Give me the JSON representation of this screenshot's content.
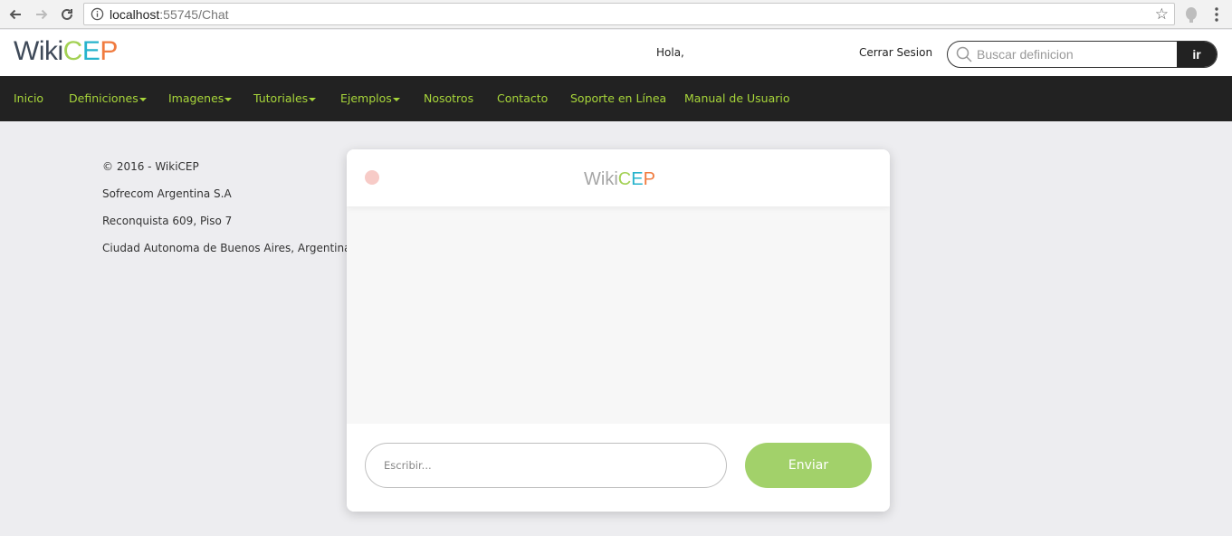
{
  "browser": {
    "url_host": "localhost",
    "url_rest": ":55745/Chat"
  },
  "header": {
    "logo": {
      "wiki": "Wiki",
      "c": "C",
      "e": "E",
      "p": "P"
    },
    "greeting": "Hola,",
    "logout_label": "Cerrar Sesion",
    "search_placeholder": "Buscar definicion",
    "search_button": "ir"
  },
  "nav": {
    "items": [
      {
        "label": "Inicio",
        "dropdown": false
      },
      {
        "label": "Definiciones",
        "dropdown": true
      },
      {
        "label": "Imagenes",
        "dropdown": true
      },
      {
        "label": "Tutoriales",
        "dropdown": true
      },
      {
        "label": "Ejemplos",
        "dropdown": true
      },
      {
        "label": "Nosotros",
        "dropdown": false
      },
      {
        "label": "Contacto",
        "dropdown": false
      },
      {
        "label": "Soporte en Línea",
        "dropdown": false
      },
      {
        "label": "Manual de Usuario",
        "dropdown": false
      }
    ]
  },
  "footer_info": [
    "© 2016 - WikiCEP",
    "Sofrecom Argentina S.A",
    "Reconquista 609, Piso 7",
    "Ciudad Autonoma de Buenos Aires, Argentina"
  ],
  "chat": {
    "title": {
      "wiki": "Wiki",
      "c": "C",
      "e": "E",
      "p": "P"
    },
    "input_placeholder": "Escribir...",
    "send_label": "Enviar"
  },
  "colors": {
    "nav_text": "#a7d53a",
    "brand_c": "#a3d154",
    "brand_e": "#26b3cc",
    "brand_p": "#f07b3f",
    "send_button": "#a2d16a",
    "status_dot": "#f7cbc7"
  }
}
